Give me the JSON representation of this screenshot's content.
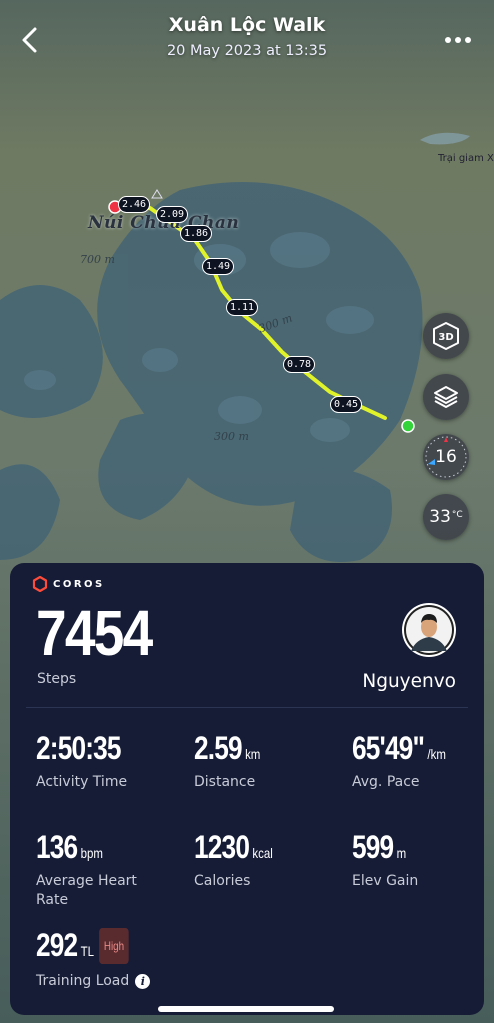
{
  "header": {
    "title": "Xuân Lộc Walk",
    "datetime": "20 May 2023 at 13:35"
  },
  "map": {
    "peak_label": "Núi Chúa Chan",
    "place_label": "Trại giam X",
    "contours": [
      "700 m",
      "300 m",
      "300 m"
    ],
    "km_markers": [
      "2.46",
      "2.09",
      "1.86",
      "1.49",
      "1.11",
      "0.78",
      "0.45"
    ],
    "controls": {
      "view_3d_label": "3D",
      "compass_value": "16",
      "temperature_value": "33",
      "temperature_unit": "°C"
    },
    "colors": {
      "route": "#e0f22a",
      "start": "#33d33a",
      "end": "#ee3344"
    }
  },
  "card": {
    "brand": "COROS",
    "steps_value": "7454",
    "steps_label": "Steps",
    "user_name": "Nguyenvo",
    "stats": [
      {
        "value": "2:50:35",
        "unit": "",
        "label": "Activity Time"
      },
      {
        "value": "2.59",
        "unit": "km",
        "label": "Distance"
      },
      {
        "value": "65'49\"",
        "unit": "/km",
        "label": "Avg. Pace"
      },
      {
        "value": "136",
        "unit": "bpm",
        "label": "Average Heart Rate"
      },
      {
        "value": "1230",
        "unit": "kcal",
        "label": "Calories"
      },
      {
        "value": "599",
        "unit": "m",
        "label": "Elev Gain"
      }
    ],
    "training_load": {
      "value": "292",
      "unit": "TL",
      "badge": "High",
      "label": "Training Load"
    }
  }
}
